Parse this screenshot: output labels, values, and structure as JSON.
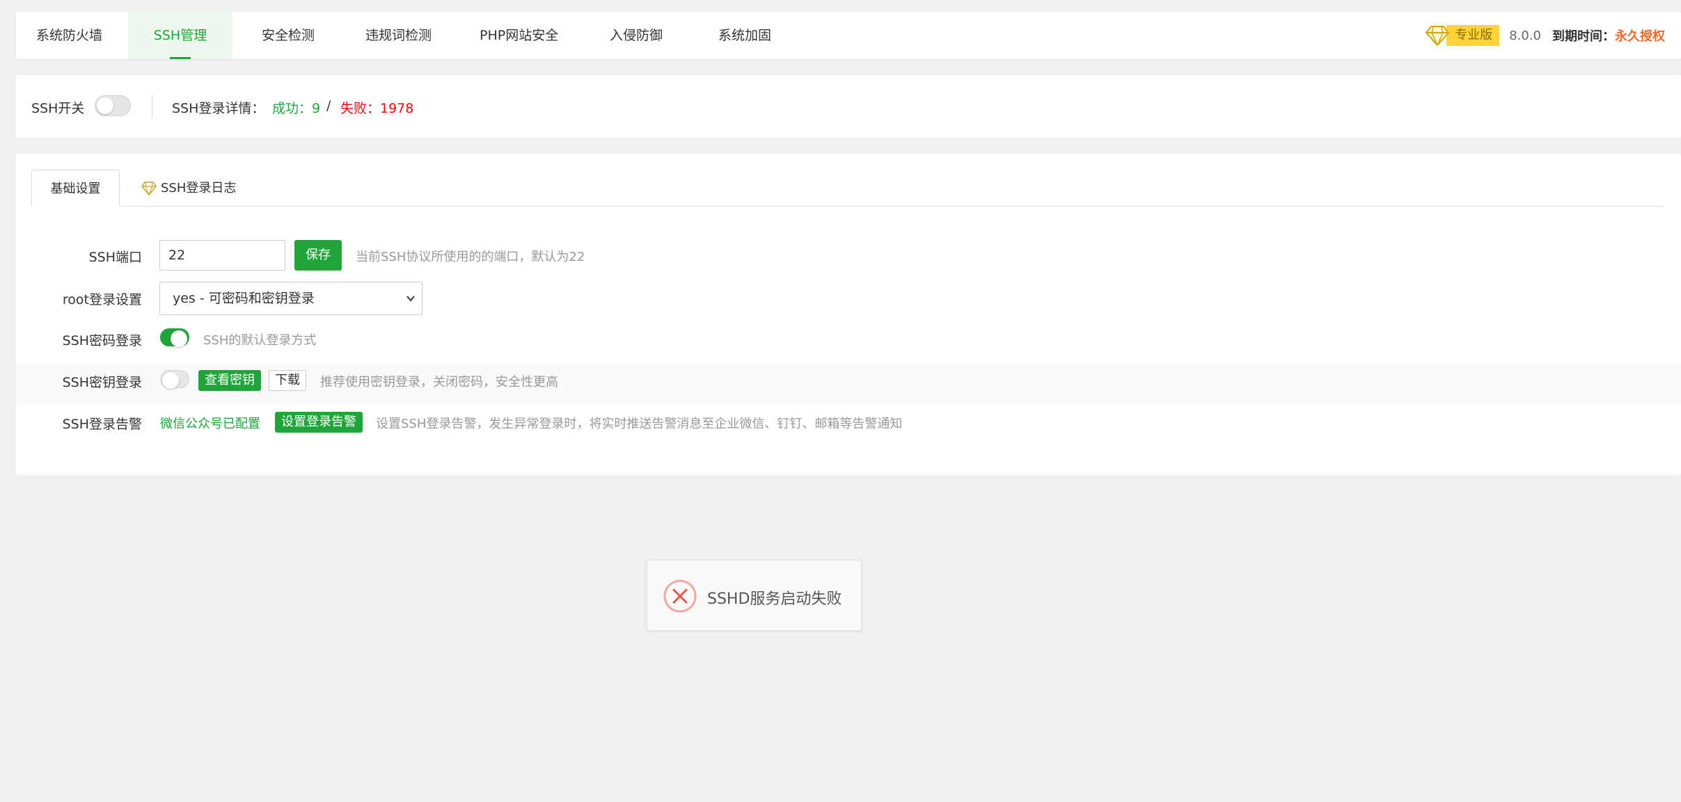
{
  "topnav": {
    "tabs": [
      {
        "label": "系统防火墙"
      },
      {
        "label": "SSH管理"
      },
      {
        "label": "安全检测"
      },
      {
        "label": "违规词检测"
      },
      {
        "label": "PHP网站安全"
      },
      {
        "label": "入侵防御"
      },
      {
        "label": "系统加固"
      }
    ],
    "active_tab": "SSH管理",
    "pro_badge": "专业版",
    "version": "8.0.0",
    "expire_label": "到期时间：",
    "expire_value": "永久授权"
  },
  "status": {
    "switch_label": "SSH开关",
    "switch_on": false,
    "detail_label": "SSH登录详情：",
    "success": "成功：9",
    "separator": "/",
    "fail": "失败：1978"
  },
  "main": {
    "tabs": [
      {
        "label": "基础设置"
      },
      {
        "label": "SSH登录日志"
      }
    ],
    "port": {
      "label": "SSH端口",
      "value": "22",
      "save_label": "保存",
      "hint": "当前SSH协议所使用的的端口，默认为22"
    },
    "root_login": {
      "label": "root登录设置",
      "selected": "yes - 可密码和密钥登录"
    },
    "password_login": {
      "label": "SSH密码登录",
      "enabled": true,
      "hint": "SSH的默认登录方式"
    },
    "key_login": {
      "label": "SSH密钥登录",
      "enabled": false,
      "view_key_label": "查看密钥",
      "download_label": "下载",
      "hint": "推荐使用密钥登录，关闭密码，安全性更高"
    },
    "alarm": {
      "label": "SSH登录告警",
      "status_link": "微信公众号已配置",
      "set_label": "设置登录告警",
      "hint": "设置SSH登录告警，发生异常登录时，将实时推送告警消息至企业微信、钉钉、邮箱等告警通知"
    }
  },
  "toast": {
    "message": "SSHD服务启动失败"
  },
  "colors": {
    "accent": "#20a53a",
    "error": "#ef0808",
    "warning": "#ef6a2a",
    "pro_badge": "#fcd43a"
  }
}
